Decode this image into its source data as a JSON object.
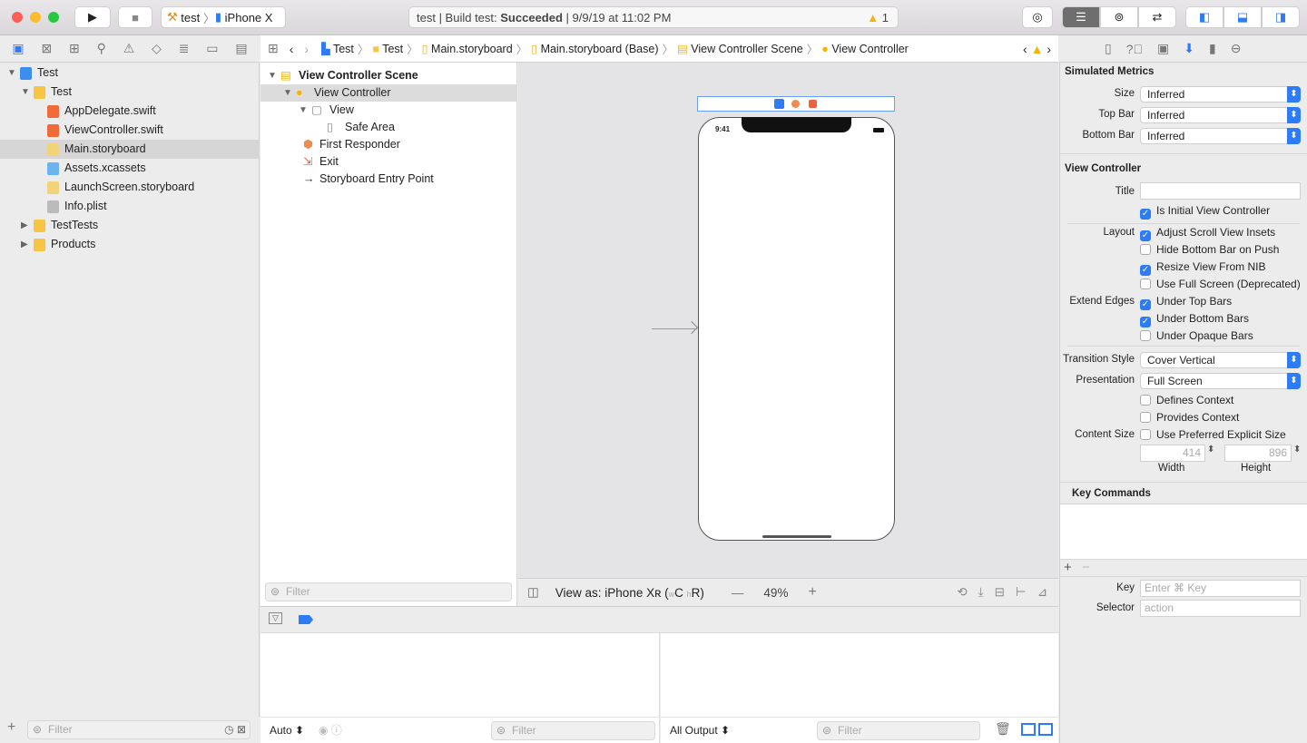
{
  "toolbar": {
    "scheme": "test",
    "device": "iPhone X",
    "status_prefix": "test | Build test: ",
    "status_result": "Succeeded",
    "status_time": " | 9/9/19 at 11:02 PM",
    "warning_count": "1"
  },
  "jumpbar": {
    "items": [
      "Test",
      "Test",
      "Main.storyboard",
      "Main.storyboard (Base)",
      "View Controller Scene",
      "View Controller"
    ]
  },
  "navigator": {
    "items": [
      {
        "label": "Test",
        "depth": 0,
        "type": "project",
        "expanded": true
      },
      {
        "label": "Test",
        "depth": 1,
        "type": "folder",
        "expanded": true
      },
      {
        "label": "AppDelegate.swift",
        "depth": 2,
        "type": "swift"
      },
      {
        "label": "ViewController.swift",
        "depth": 2,
        "type": "swift"
      },
      {
        "label": "Main.storyboard",
        "depth": 2,
        "type": "storyboard",
        "selected": true
      },
      {
        "label": "Assets.xcassets",
        "depth": 2,
        "type": "assets"
      },
      {
        "label": "LaunchScreen.storyboard",
        "depth": 2,
        "type": "storyboard"
      },
      {
        "label": "Info.plist",
        "depth": 2,
        "type": "plist"
      },
      {
        "label": "TestTests",
        "depth": 1,
        "type": "folder",
        "expanded": false
      },
      {
        "label": "Products",
        "depth": 1,
        "type": "folder",
        "expanded": false
      }
    ],
    "filter_placeholder": "Filter"
  },
  "outline": {
    "items": [
      {
        "label": "View Controller Scene",
        "depth": 0,
        "bold": true
      },
      {
        "label": "View Controller",
        "depth": 1,
        "selected": true
      },
      {
        "label": "View",
        "depth": 2
      },
      {
        "label": "Safe Area",
        "depth": 3
      },
      {
        "label": "First Responder",
        "depth": 1
      },
      {
        "label": "Exit",
        "depth": 1
      },
      {
        "label": "Storyboard Entry Point",
        "depth": 1
      }
    ],
    "filter_placeholder": "Filter"
  },
  "canvas": {
    "device_time": "9:41",
    "view_as": "View as: iPhone Xʀ (",
    "w": "w",
    "c": "C",
    "h": "h",
    "r": "R)",
    "zoom": "49%"
  },
  "debug": {
    "auto": "Auto ⬍",
    "filter_placeholder": "Filter",
    "all_output": "All Output ⬍"
  },
  "inspector": {
    "simulated_metrics": "Simulated Metrics",
    "size_label": "Size",
    "size": "Inferred",
    "topbar_label": "Top Bar",
    "topbar": "Inferred",
    "bottombar_label": "Bottom Bar",
    "bottombar": "Inferred",
    "vc_section": "View Controller",
    "title_label": "Title",
    "title_value": "",
    "checks": [
      {
        "group": "",
        "label": "Is Initial View Controller",
        "checked": true
      },
      {
        "group": "Layout",
        "label": "Adjust Scroll View Insets",
        "checked": true
      },
      {
        "group": "",
        "label": "Hide Bottom Bar on Push",
        "checked": false
      },
      {
        "group": "",
        "label": "Resize View From NIB",
        "checked": true
      },
      {
        "group": "",
        "label": "Use Full Screen (Deprecated)",
        "checked": false
      },
      {
        "group": "Extend Edges",
        "label": "Under Top Bars",
        "checked": true
      },
      {
        "group": "",
        "label": "Under Bottom Bars",
        "checked": true
      },
      {
        "group": "",
        "label": "Under Opaque Bars",
        "checked": false
      }
    ],
    "transition_label": "Transition Style",
    "transition": "Cover Vertical",
    "presentation_label": "Presentation",
    "presentation": "Full Screen",
    "checks2": [
      {
        "group": "",
        "label": "Defines Context",
        "checked": false
      },
      {
        "group": "",
        "label": "Provides Context",
        "checked": false
      },
      {
        "group": "Content Size",
        "label": "Use Preferred Explicit Size",
        "checked": false
      }
    ],
    "width": "414",
    "height": "896",
    "width_label": "Width",
    "height_label": "Height",
    "key_commands": "Key Commands",
    "key_label": "Key",
    "key_placeholder": "Enter ⌘ Key",
    "selector_label": "Selector",
    "selector_placeholder": "action"
  },
  "colors": {
    "accent": "#2d7bf6",
    "warning": "#f5b400",
    "folder": "#f7c444"
  }
}
